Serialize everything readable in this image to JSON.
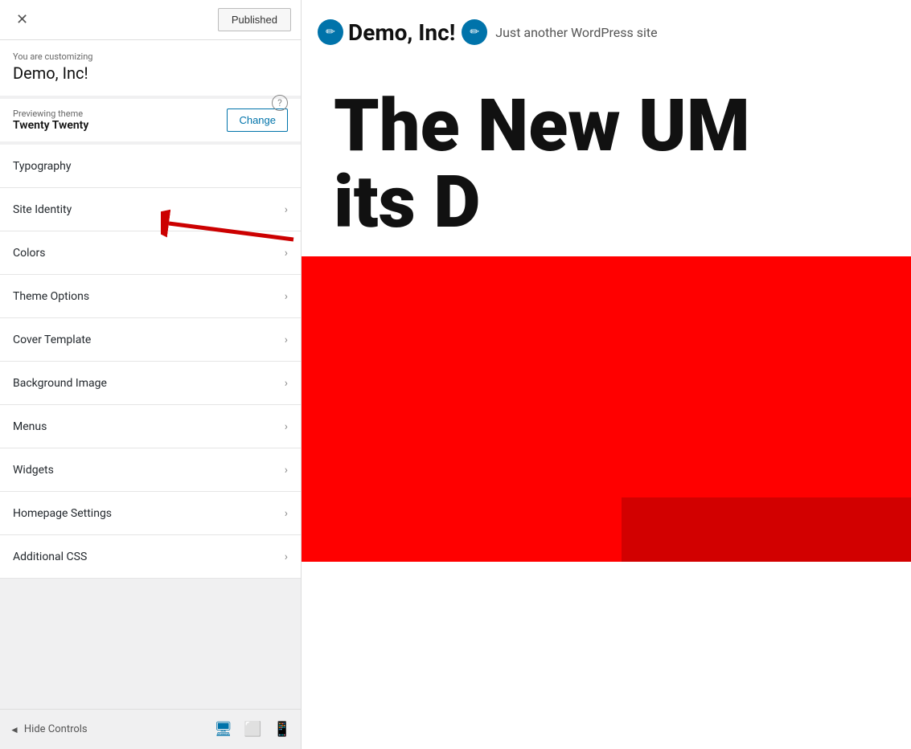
{
  "topbar": {
    "close_label": "✕",
    "published_label": "Published"
  },
  "customizing": {
    "label": "You are customizing",
    "title": "Demo, Inc!",
    "help_icon": "?"
  },
  "theme": {
    "label": "Previewing theme",
    "name": "Twenty Twenty",
    "change_label": "Change"
  },
  "menu_items": [
    {
      "label": "Typography",
      "has_arrow": false
    },
    {
      "label": "Site Identity",
      "has_arrow": true
    },
    {
      "label": "Colors",
      "has_arrow": true
    },
    {
      "label": "Theme Options",
      "has_arrow": true
    },
    {
      "label": "Cover Template",
      "has_arrow": true
    },
    {
      "label": "Background Image",
      "has_arrow": true
    },
    {
      "label": "Menus",
      "has_arrow": true
    },
    {
      "label": "Widgets",
      "has_arrow": true
    },
    {
      "label": "Homepage Settings",
      "has_arrow": true
    },
    {
      "label": "Additional CSS",
      "has_arrow": true
    }
  ],
  "bottom_bar": {
    "hide_controls_label": "Hide Controls"
  },
  "preview": {
    "edit_icon": "✏",
    "site_title": "Demo, Inc!",
    "site_tagline": "Just another WordPress site",
    "hero_line1": "The New UM",
    "hero_line2": "its D"
  }
}
